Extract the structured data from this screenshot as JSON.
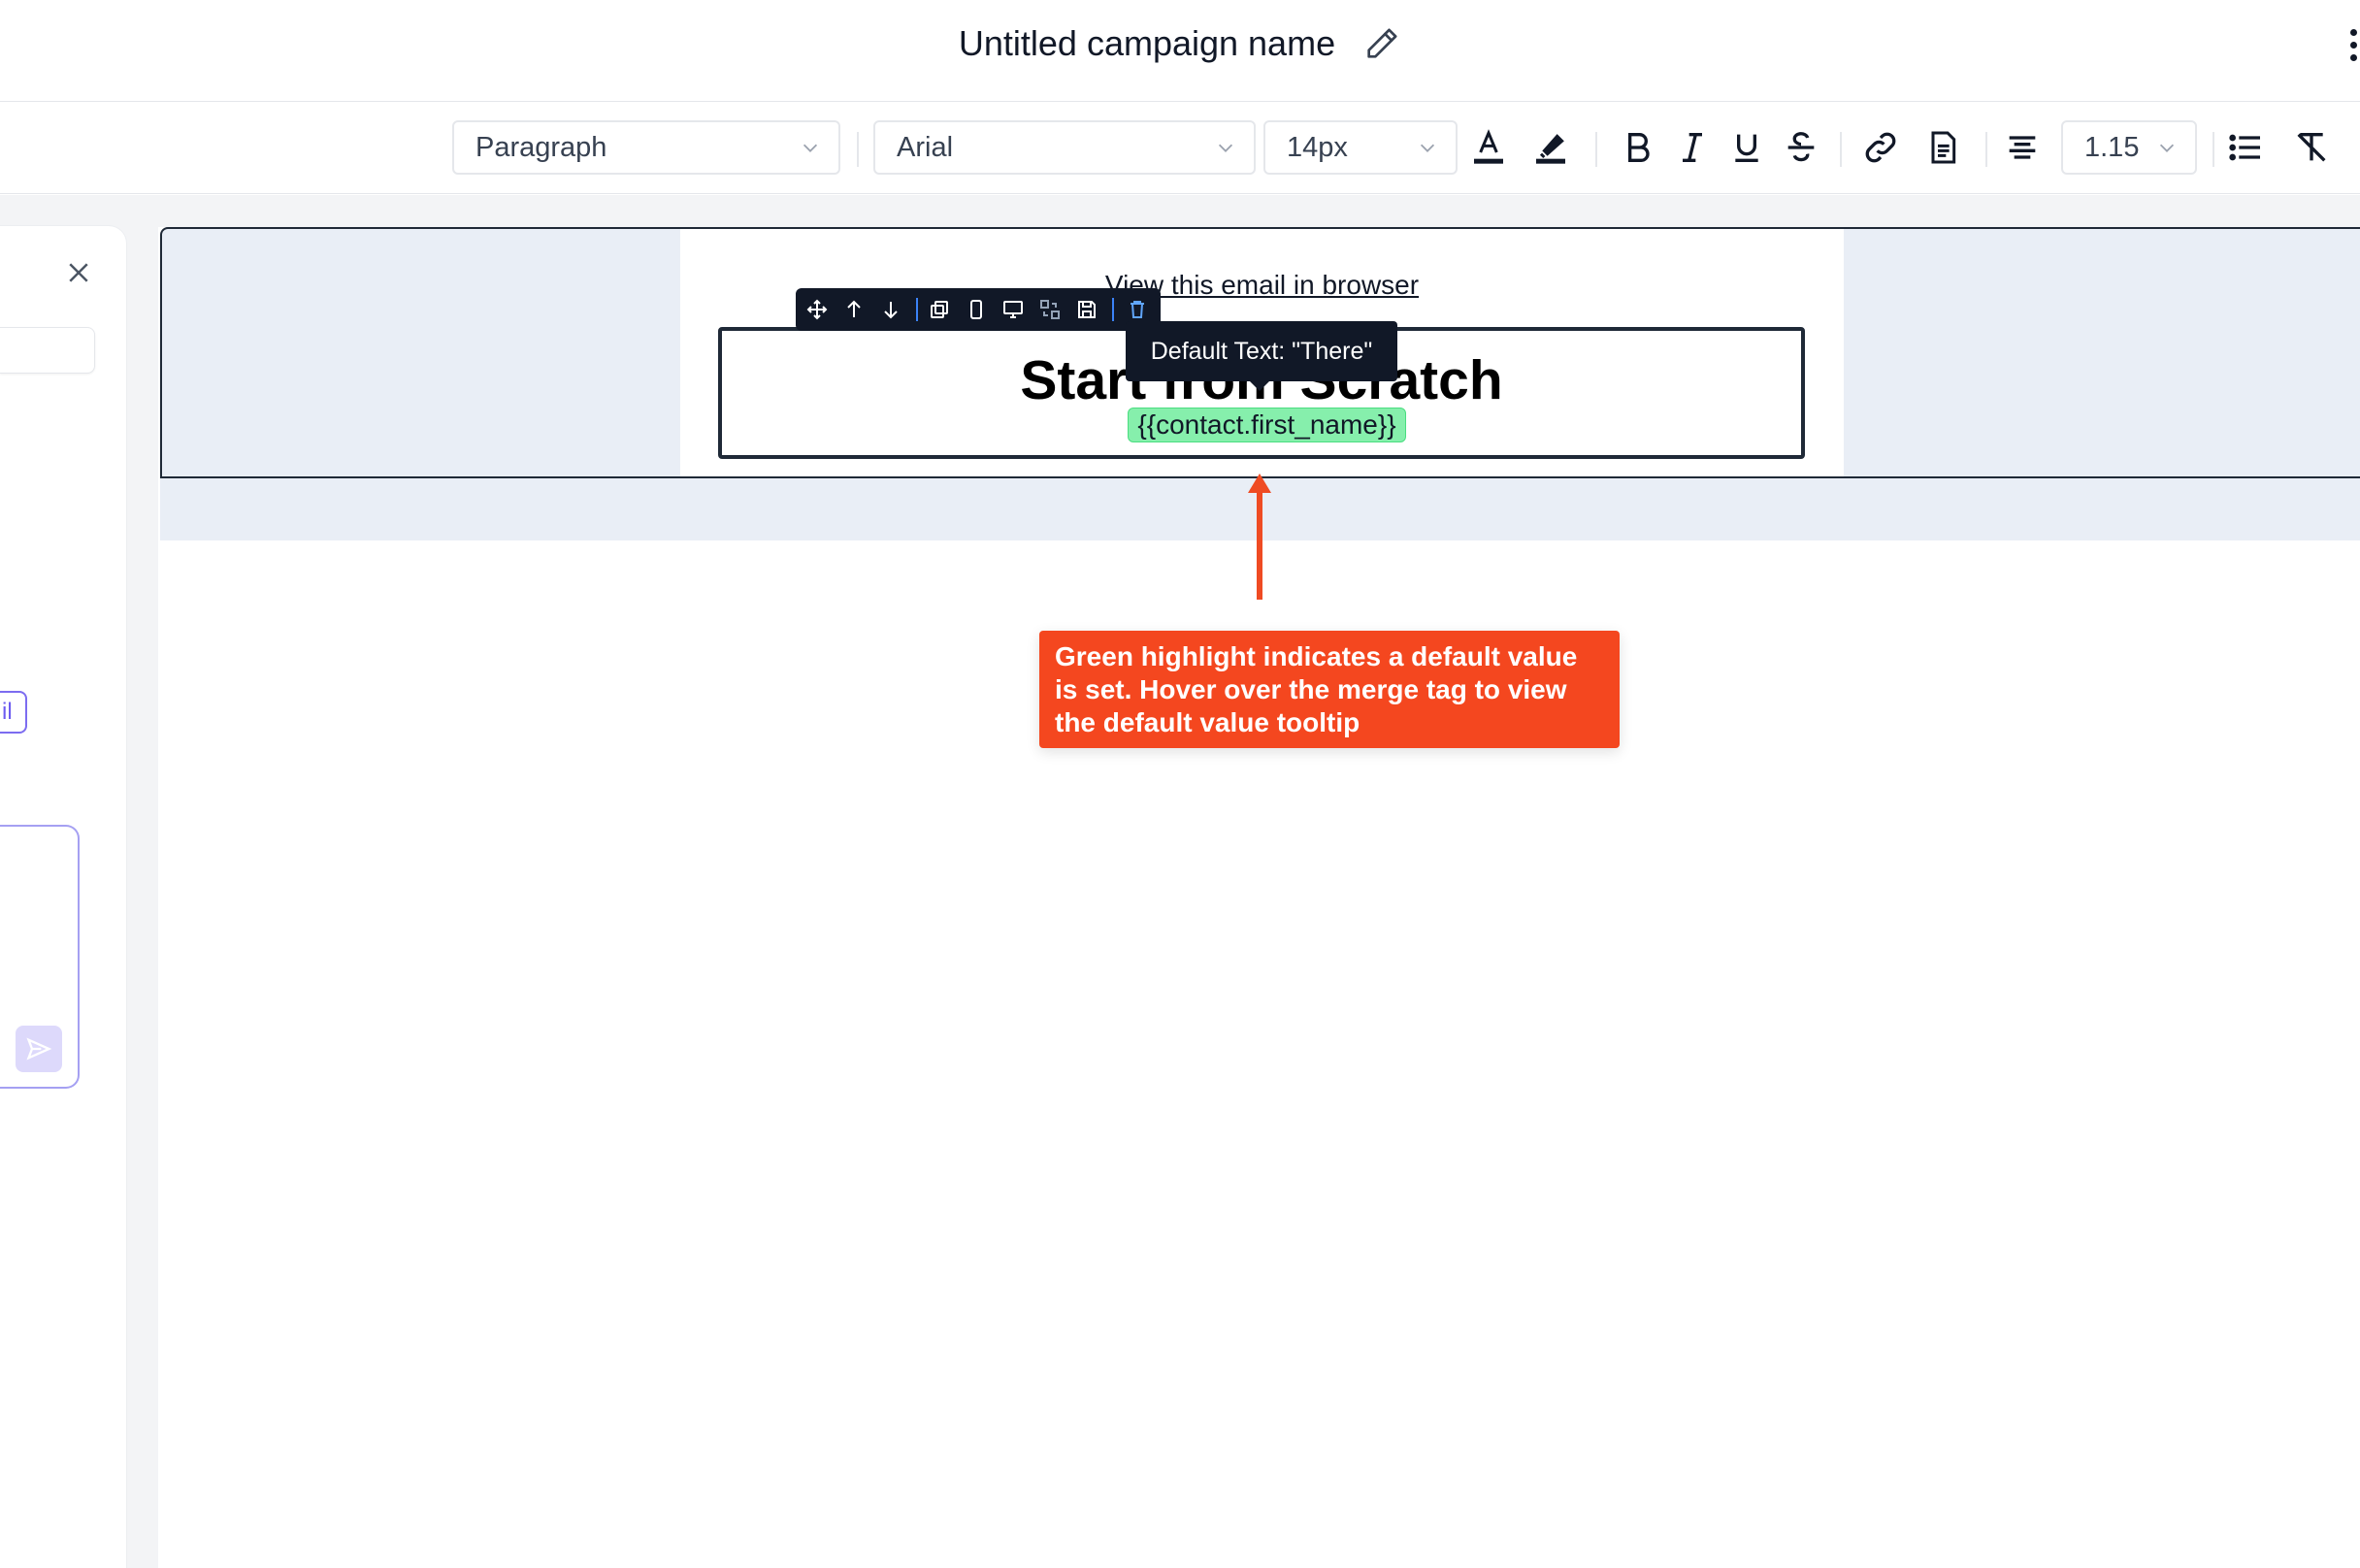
{
  "header": {
    "campaign_name": "Untitled campaign name"
  },
  "toolbar": {
    "block_type": "Paragraph",
    "font_family": "Arial",
    "font_size": "14px",
    "line_height": "1.15"
  },
  "left_panel": {
    "chip_label": "il"
  },
  "email": {
    "view_in_browser": "View this email in browser",
    "heading": "Start from Scratch",
    "merge_tag": "{{contact.first_name}}",
    "merge_tag_color": "#86efac"
  },
  "tooltip": {
    "text": "Default Text: \"There\""
  },
  "callout": {
    "text": "Green highlight indicates a default value is set. Hover over the merge tag to view the default value tooltip",
    "color": "#f4471f"
  }
}
